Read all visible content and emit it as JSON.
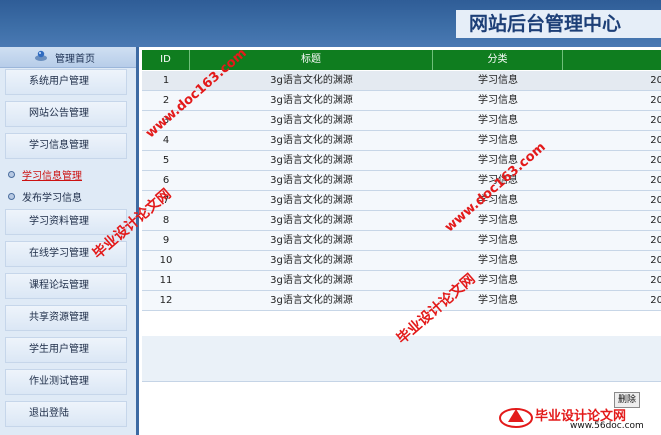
{
  "header": {
    "title": "网站后台管理中心"
  },
  "sidebar": {
    "home_label": "管理首页",
    "items": [
      {
        "label": "系统用户管理"
      },
      {
        "label": "网站公告管理"
      },
      {
        "label": "学习信息管理"
      },
      {
        "label": "学习资料管理"
      },
      {
        "label": "在线学习管理"
      },
      {
        "label": "课程论坛管理"
      },
      {
        "label": "共享资源管理"
      },
      {
        "label": "学生用户管理"
      },
      {
        "label": "作业测试管理"
      },
      {
        "label": "退出登陆"
      }
    ],
    "sub_items": [
      {
        "label": "学习信息管理",
        "active": true
      },
      {
        "label": "发布学习信息",
        "active": false
      }
    ]
  },
  "table": {
    "columns": [
      "ID",
      "标题",
      "分类"
    ],
    "rows": [
      {
        "id": "1",
        "title": "3g语言文化的渊源",
        "category": "学习信息",
        "date": "20"
      },
      {
        "id": "2",
        "title": "3g语言文化的渊源",
        "category": "学习信息",
        "date": "20"
      },
      {
        "id": "3",
        "title": "3g语言文化的渊源",
        "category": "学习信息",
        "date": "20"
      },
      {
        "id": "4",
        "title": "3g语言文化的渊源",
        "category": "学习信息",
        "date": "20"
      },
      {
        "id": "5",
        "title": "3g语言文化的渊源",
        "category": "学习信息",
        "date": "20"
      },
      {
        "id": "6",
        "title": "3g语言文化的渊源",
        "category": "学习信息",
        "date": "20"
      },
      {
        "id": "7",
        "title": "3g语言文化的渊源",
        "category": "学习信息",
        "date": "20"
      },
      {
        "id": "8",
        "title": "3g语言文化的渊源",
        "category": "学习信息",
        "date": "20"
      },
      {
        "id": "9",
        "title": "3g语言文化的渊源",
        "category": "学习信息",
        "date": "20"
      },
      {
        "id": "10",
        "title": "3g语言文化的渊源",
        "category": "学习信息",
        "date": "20"
      },
      {
        "id": "11",
        "title": "3g语言文化的渊源",
        "category": "学习信息",
        "date": "20"
      },
      {
        "id": "12",
        "title": "3g语言文化的渊源",
        "category": "学习信息",
        "date": "20"
      }
    ],
    "delete_label": "删除"
  },
  "watermark": {
    "site_name": "毕业设计论文网",
    "url": "www.doc163.com",
    "footer_url": "www.56doc.com"
  },
  "colors": {
    "header_bg": "#3e6fa8",
    "table_header_bg": "#0f7d1f",
    "sidebar_bg": "#dfeaf6",
    "watermark": "#e31a1a"
  }
}
